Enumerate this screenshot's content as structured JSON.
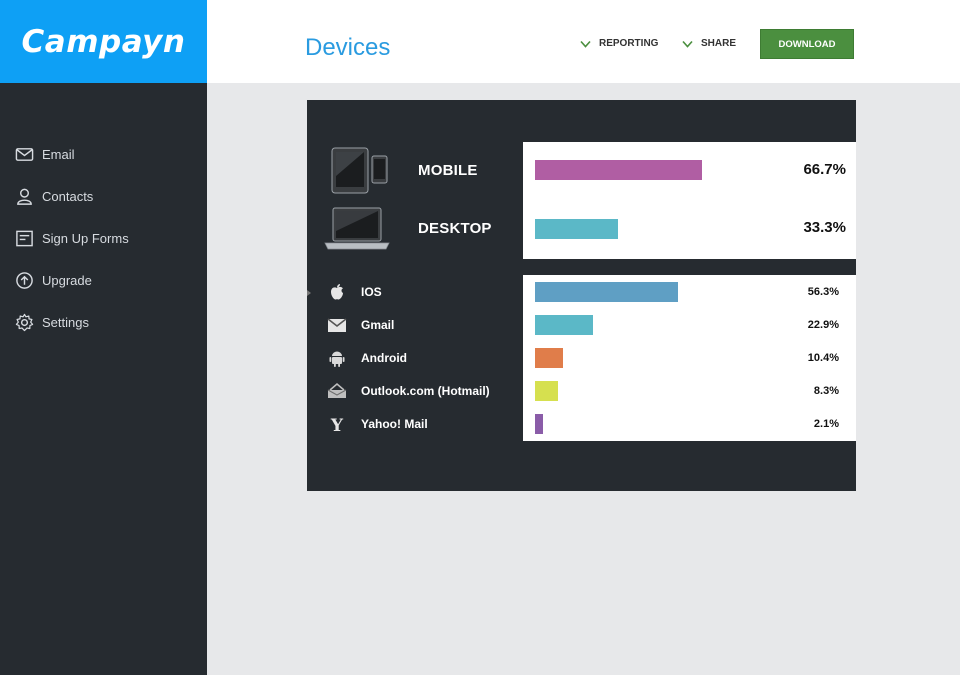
{
  "brand": {
    "name": "Campayn"
  },
  "sidebar": {
    "items": [
      {
        "label": "Email",
        "icon": "envelope-icon"
      },
      {
        "label": "Contacts",
        "icon": "person-icon"
      },
      {
        "label": "Sign Up Forms",
        "icon": "form-icon"
      },
      {
        "label": "Upgrade",
        "icon": "upgrade-arrow-icon"
      },
      {
        "label": "Settings",
        "icon": "gear-icon"
      }
    ]
  },
  "header": {
    "title": "Devices",
    "reporting_label": "REPORTING",
    "share_label": "SHARE",
    "download_label": "DOWNLOAD"
  },
  "devices": {
    "platforms": [
      {
        "label": "MOBILE",
        "percent_text": "66.7%",
        "value": 66.7,
        "color": "#b05ea3",
        "icon": "tablet-phone-icon"
      },
      {
        "label": "DESKTOP",
        "percent_text": "33.3%",
        "value": 33.3,
        "color": "#5bb8c7",
        "icon": "laptop-icon"
      }
    ],
    "clients": [
      {
        "label": "IOS",
        "percent_text": "56.3%",
        "value": 56.3,
        "color": "#5f9fc4",
        "icon": "apple-icon"
      },
      {
        "label": "Gmail",
        "percent_text": "22.9%",
        "value": 22.9,
        "color": "#5bb8c7",
        "icon": "gmail-icon"
      },
      {
        "label": "Android",
        "percent_text": "10.4%",
        "value": 10.4,
        "color": "#e07d4a",
        "icon": "android-icon"
      },
      {
        "label": "Outlook.com (Hotmail)",
        "percent_text": "8.3%",
        "value": 8.3,
        "color": "#d6e04f",
        "icon": "outlook-icon"
      },
      {
        "label": "Yahoo! Mail",
        "percent_text": "2.1%",
        "value": 2.1,
        "color": "#8a5ca8",
        "icon": "yahoo-icon"
      }
    ]
  }
}
